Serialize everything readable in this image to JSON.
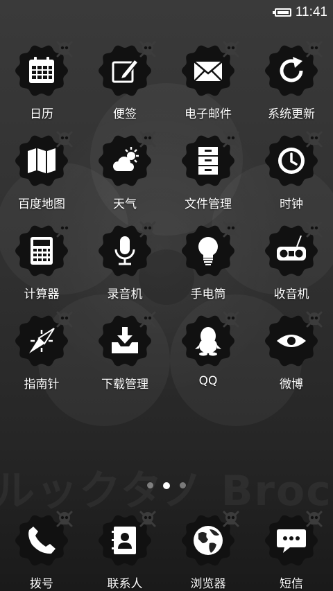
{
  "status": {
    "time": "11:41"
  },
  "background": {
    "brand_text": "ルックタノ Broc"
  },
  "apps": [
    [
      {
        "id": "calendar",
        "label": "日历",
        "icon": "calendar-icon"
      },
      {
        "id": "notes",
        "label": "便签",
        "icon": "note-edit-icon"
      },
      {
        "id": "email",
        "label": "电子邮件",
        "icon": "envelope-icon"
      },
      {
        "id": "system-update",
        "label": "系统更新",
        "icon": "refresh-icon"
      }
    ],
    [
      {
        "id": "baidu-map",
        "label": "百度地图",
        "icon": "map-icon"
      },
      {
        "id": "weather",
        "label": "天气",
        "icon": "cloud-sun-icon"
      },
      {
        "id": "file-manager",
        "label": "文件管理",
        "icon": "file-cabinet-icon"
      },
      {
        "id": "clock",
        "label": "时钟",
        "icon": "clock-icon"
      }
    ],
    [
      {
        "id": "calculator",
        "label": "计算器",
        "icon": "calculator-icon"
      },
      {
        "id": "recorder",
        "label": "录音机",
        "icon": "microphone-icon"
      },
      {
        "id": "flashlight",
        "label": "手电筒",
        "icon": "lightbulb-icon"
      },
      {
        "id": "radio",
        "label": "收音机",
        "icon": "radio-icon"
      }
    ],
    [
      {
        "id": "compass",
        "label": "指南针",
        "icon": "compass-icon"
      },
      {
        "id": "download-manager",
        "label": "下载管理",
        "icon": "download-tray-icon"
      },
      {
        "id": "qq",
        "label": "QQ",
        "icon": "qq-penguin-icon"
      },
      {
        "id": "weibo",
        "label": "微博",
        "icon": "eye-icon"
      }
    ]
  ],
  "pager": {
    "pages": 3,
    "active": 1
  },
  "dock": [
    {
      "id": "dialer",
      "label": "拨号",
      "icon": "phone-icon"
    },
    {
      "id": "contacts",
      "label": "联系人",
      "icon": "contacts-book-icon"
    },
    {
      "id": "browser",
      "label": "浏览器",
      "icon": "globe-icon"
    },
    {
      "id": "sms",
      "label": "短信",
      "icon": "chat-bubble-icon"
    }
  ],
  "colors": {
    "icon_bg": "#111111",
    "glyph": "#ffffff",
    "skull": "#3c3c3c"
  }
}
